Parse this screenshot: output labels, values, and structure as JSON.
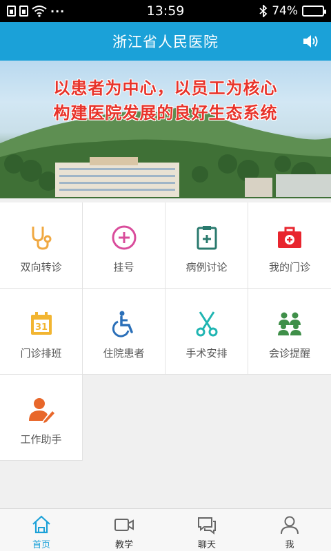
{
  "status_bar": {
    "time": "13:59",
    "battery_text": "74%",
    "battery_level": 0.74,
    "more": "···"
  },
  "header": {
    "title": "浙江省人民医院"
  },
  "banner": {
    "slogan_line1": "以患者为中心，以员工为核心",
    "slogan_line2": "构建医院发展的良好生态系统"
  },
  "grid": {
    "items": [
      {
        "label": "双向转诊",
        "icon": "stethoscope-icon",
        "color": "#f0a841"
      },
      {
        "label": "挂号",
        "icon": "plus-circle-icon",
        "color": "#d94c9b"
      },
      {
        "label": "病例讨论",
        "icon": "clipboard-plus-icon",
        "color": "#2a7a6e"
      },
      {
        "label": "我的门诊",
        "icon": "medical-kit-icon",
        "color": "#e8252e"
      },
      {
        "label": "门诊排班",
        "icon": "calendar-31-icon",
        "color": "#f2b531"
      },
      {
        "label": "住院患者",
        "icon": "wheelchair-icon",
        "color": "#2a6fb8"
      },
      {
        "label": "手术安排",
        "icon": "scissors-icon",
        "color": "#1fb5b2"
      },
      {
        "label": "会诊提醒",
        "icon": "group-icon",
        "color": "#3f8f49"
      },
      {
        "label": "工作助手",
        "icon": "user-edit-icon",
        "color": "#e8672a"
      }
    ]
  },
  "tabbar": {
    "tabs": [
      {
        "label": "首页",
        "icon": "home-icon",
        "active": true
      },
      {
        "label": "教学",
        "icon": "video-icon",
        "active": false
      },
      {
        "label": "聊天",
        "icon": "chat-icon",
        "active": false
      },
      {
        "label": "我",
        "icon": "user-icon",
        "active": false
      }
    ],
    "active_color": "#1ba1d8"
  }
}
